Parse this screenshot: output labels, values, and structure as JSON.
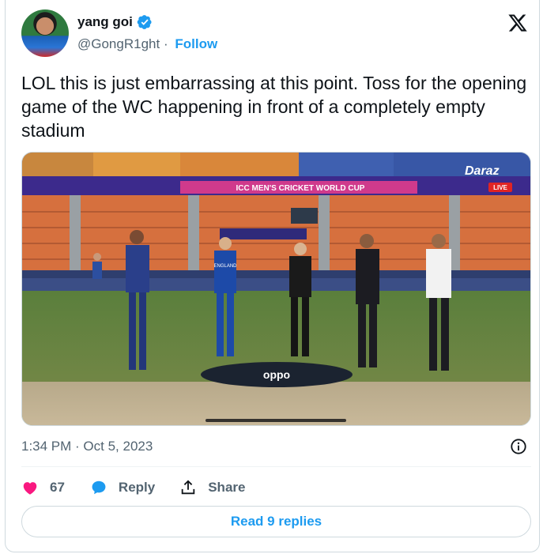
{
  "author": {
    "display_name": "yang goi",
    "handle": "@GongR1ght",
    "separator": "·",
    "follow_label": "Follow"
  },
  "tweet": {
    "text": "LOL this is just embarrassing at this point. Toss for the opening game of the WC happening in front of a completely empty stadium",
    "timestamp": "1:34 PM · Oct 5, 2023"
  },
  "media": {
    "banner_text": "ICC MEN'S CRICKET WORLD CUP",
    "broadcaster": "Daraz",
    "live_label": "LIVE",
    "sponsor_mat": "oppo",
    "player_left_jersey": "ENGLAND"
  },
  "actions": {
    "like_count": "67",
    "reply_label": "Reply",
    "share_label": "Share"
  },
  "read_replies_label": "Read 9 replies",
  "colors": {
    "accent": "#1d9bf0",
    "like": "#f91880",
    "muted": "#536471"
  }
}
